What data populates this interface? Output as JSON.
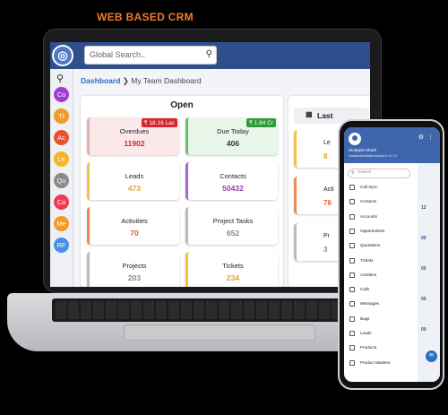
{
  "headline": "WEB BASED CRM",
  "app": {
    "search_placeholder": "Global Search..",
    "breadcrumb": {
      "root": "Dashboard",
      "separator": "❯",
      "current": "My Team Dashboard"
    },
    "sidebar_items": [
      {
        "label": "Co",
        "color": "#a23bd6"
      },
      {
        "label": "Tl",
        "color": "#f29a25"
      },
      {
        "label": "Ac",
        "color": "#e7532f"
      },
      {
        "label": "Le",
        "color": "#f5b625"
      },
      {
        "label": "Qu",
        "color": "#8a8a8a"
      },
      {
        "label": "Ca",
        "color": "#ef3a54"
      },
      {
        "label": "Me",
        "color": "#f29a25"
      },
      {
        "label": "RF",
        "color": "#4a90e2"
      }
    ],
    "open_panel": {
      "title": "Open",
      "cards": [
        {
          "label": "Overdues",
          "value": "11902",
          "tag": "₹ 18.16 Lac",
          "tag_color": "#d7262b",
          "value_color": "#c9262b",
          "accent": "#e3b0b2",
          "bg": "#fbe9ea"
        },
        {
          "label": "Due Today",
          "value": "406",
          "tag": "₹ 1.84 Cr",
          "tag_color": "#2e9a3a",
          "value_color": "#333333",
          "accent": "#6bbf6f",
          "bg": "#e8f6e9"
        },
        {
          "label": "Leads",
          "value": "473",
          "tag": "",
          "tag_color": "",
          "value_color": "#e2a02a",
          "accent": "#f2c24b",
          "bg": "#ffffff"
        },
        {
          "label": "Contacts",
          "value": "50432",
          "tag": "",
          "tag_color": "",
          "value_color": "#8e44ad",
          "accent": "#a569d2",
          "bg": "#ffffff"
        },
        {
          "label": "Activities",
          "value": "70",
          "tag": "",
          "tag_color": "",
          "value_color": "#e05a2b",
          "accent": "#ef8a55",
          "bg": "#ffffff"
        },
        {
          "label": "Project Tasks",
          "value": "652",
          "tag": "",
          "tag_color": "",
          "value_color": "#888888",
          "accent": "#bbbbbb",
          "bg": "#ffffff"
        },
        {
          "label": "Projects",
          "value": "203",
          "tag": "",
          "tag_color": "",
          "value_color": "#888888",
          "accent": "#bbbbbb",
          "bg": "#ffffff"
        },
        {
          "label": "Tickets",
          "value": "234",
          "tag": "",
          "tag_color": "",
          "value_color": "#e2a02a",
          "accent": "#f2c24b",
          "bg": "#ffffff"
        }
      ]
    },
    "last_panel": {
      "title": "Last",
      "cards": [
        {
          "label": "Le",
          "value": "8",
          "value_color": "#e2a02a",
          "accent": "#f2c24b"
        },
        {
          "label": "Acti",
          "value": "76",
          "value_color": "#e05a2b",
          "accent": "#ef8a55"
        },
        {
          "label": "Pr",
          "value": "3",
          "value_color": "#888888",
          "accent": "#bbbbbb"
        }
      ]
    }
  },
  "mobile": {
    "user_name": "Hirakjeet Sharif",
    "user_email": "hirakjeetsharif@example.in  v1.1.0",
    "search_placeholder": "Search",
    "menu": [
      "Call Sync",
      "Contacts",
      "Accounts",
      "Opportunities",
      "Quotations",
      "Tickets",
      "Activities",
      "Calls",
      "Messages",
      "Bugs",
      "Leads",
      "Products",
      "Product Masters"
    ],
    "right_counts": [
      "12",
      "00",
      "00",
      "00",
      "00"
    ],
    "fab_label": "✉"
  },
  "icons": {
    "logo": "globe-logo-icon",
    "search": "search-icon",
    "calendar": "calendar-icon",
    "settings": "gear-icon",
    "menu": "hamburger-menu-icon"
  }
}
